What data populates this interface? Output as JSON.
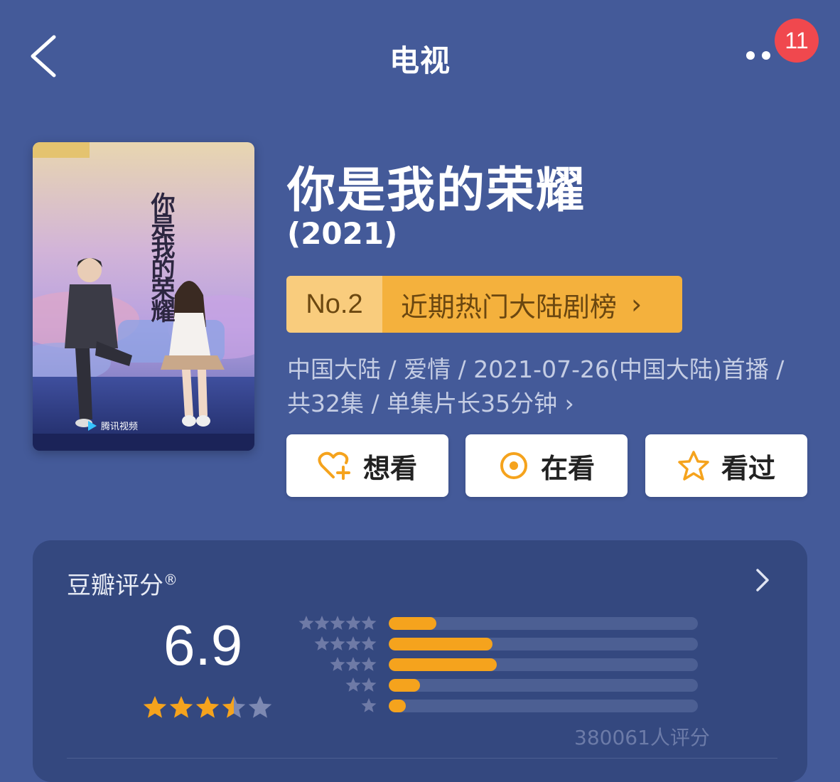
{
  "header": {
    "title": "电视",
    "notification_count": "11"
  },
  "movie": {
    "title": "你是我的荣耀",
    "year": "(2021)",
    "ranking": {
      "number": "No.2",
      "label": "近期热门大陆剧榜"
    },
    "meta_line1": "中国大陆 / 爱情 / 2021-07-26(中国大陆)首播 /",
    "meta_line2": "共32集 / 单集片长35分钟 ›",
    "poster": {
      "title_art": "你是我的荣耀",
      "platform_label": "腾讯视频"
    }
  },
  "actions": {
    "want_label": "想看",
    "watching_label": "在看",
    "watched_label": "看过"
  },
  "rating": {
    "header": "豆瓣评分",
    "registered_mark": "®",
    "score": "6.9",
    "score_stars": 3.5,
    "distribution": [
      {
        "stars": 5,
        "fraction": 0.155
      },
      {
        "stars": 4,
        "fraction": 0.335
      },
      {
        "stars": 3,
        "fraction": 0.35
      },
      {
        "stars": 2,
        "fraction": 0.1
      },
      {
        "stars": 1,
        "fraction": 0.055
      }
    ],
    "count_text": "380061人评分"
  },
  "colors": {
    "background": "#445a99",
    "card": "#34487f",
    "accent_orange": "#f5a31d",
    "rank_light": "#f9cc7d",
    "badge_red": "#f0484e"
  }
}
